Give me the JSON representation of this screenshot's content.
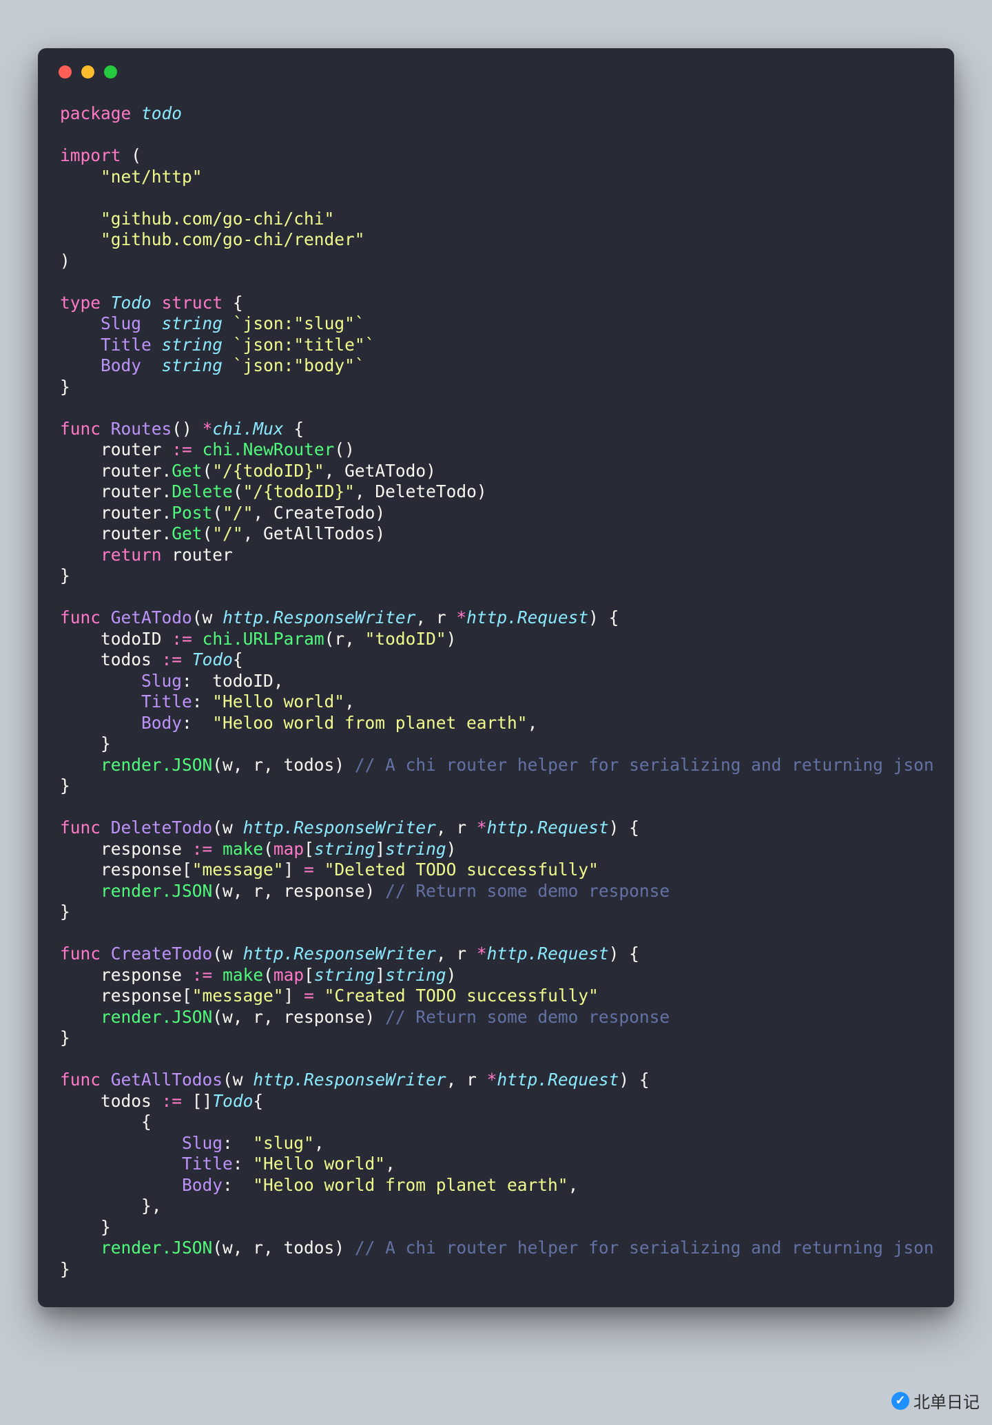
{
  "window": {
    "dots": [
      "close",
      "minimize",
      "zoom"
    ]
  },
  "code": {
    "package_kw": "package",
    "package_name": "todo",
    "import_kw": "import",
    "imports": [
      "\"net/http\"",
      "\"github.com/go-chi/chi\"",
      "\"github.com/go-chi/render\""
    ],
    "type_kw": "type",
    "struct_kw": "struct",
    "struct_name": "Todo",
    "string_kw": "string",
    "fields": [
      {
        "name": "Slug",
        "tag": "`json:\"slug\"`"
      },
      {
        "name": "Title",
        "tag": "`json:\"title\"`"
      },
      {
        "name": "Body",
        "tag": "`json:\"body\"`"
      }
    ],
    "func_kw": "func",
    "return_kw": "return",
    "routes": {
      "name": "Routes",
      "ret_type": "chi.Mux",
      "router_var": "router",
      "chi_new": "chi.NewRouter",
      "lines": [
        {
          "method": "Get",
          "path": "\"/{todoID}\"",
          "handler": "GetATodo"
        },
        {
          "method": "Delete",
          "path": "\"/{todoID}\"",
          "handler": "DeleteTodo"
        },
        {
          "method": "Post",
          "path": "\"/\"",
          "handler": "CreateTodo"
        },
        {
          "method": "Get",
          "path": "\"/\"",
          "handler": "GetAllTodos"
        }
      ]
    },
    "http_rw": "http.ResponseWriter",
    "http_req": "http.Request",
    "make_kw": "make",
    "map_kw": "map",
    "render_json": "render.JSON",
    "getatodo": {
      "name": "GetATodo",
      "var_todoID": "todoID",
      "url_param": "chi.URLParam",
      "url_key": "\"todoID\"",
      "var_todos": "todos",
      "slug_val": "todoID",
      "title_val": "\"Hello world\"",
      "body_val": "\"Heloo world from planet earth\"",
      "comment": "// A chi router helper for serializing and returning json"
    },
    "deletetodo": {
      "name": "DeleteTodo",
      "msg_key": "\"message\"",
      "msg_val": "\"Deleted TODO successfully\"",
      "comment": "// Return some demo response"
    },
    "createtodo": {
      "name": "CreateTodo",
      "msg_key": "\"message\"",
      "msg_val": "\"Created TODO successfully\"",
      "comment": "// Return some demo response"
    },
    "getalltodos": {
      "name": "GetAllTodos",
      "slug_val": "\"slug\"",
      "title_val": "\"Hello world\"",
      "body_val": "\"Heloo world from planet earth\"",
      "comment": "// A chi router helper for serializing and returning json"
    }
  },
  "watermark": {
    "text": "北单日记",
    "badge": "✓"
  }
}
